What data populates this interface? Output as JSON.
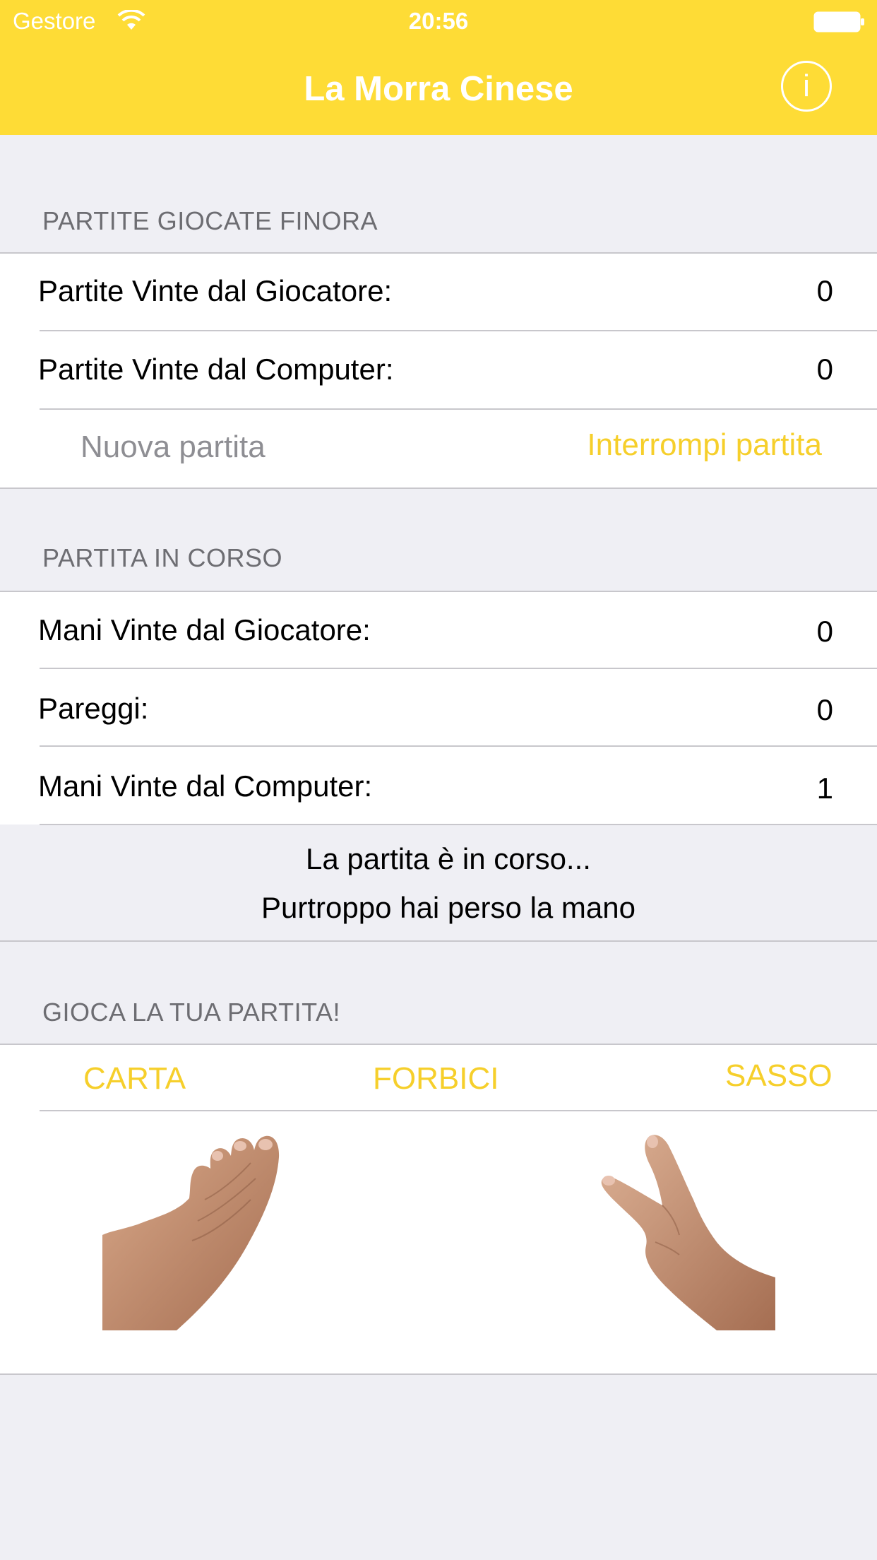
{
  "status_bar": {
    "carrier": "Gestore",
    "time": "20:56"
  },
  "nav": {
    "title": "La Morra Cinese",
    "info_label": "i"
  },
  "played": {
    "header": "PARTITE GIOCATE FINORA",
    "rows": [
      {
        "label": "Partite Vinte dal Giocatore:",
        "value": "0"
      },
      {
        "label": "Partite Vinte dal Computer:",
        "value": "0"
      }
    ],
    "new_game_label": "Nuova partita",
    "stop_game_label": "Interrompi partita"
  },
  "current": {
    "header": "PARTITA IN CORSO",
    "rows": [
      {
        "label": "Mani Vinte dal Giocatore:",
        "value": "0"
      },
      {
        "label": "Pareggi:",
        "value": "0"
      },
      {
        "label": "Mani Vinte dal Computer:",
        "value": "1"
      }
    ],
    "status_line1": "La partita è in corso...",
    "status_line2": "Purtroppo hai perso la mano"
  },
  "play": {
    "header": "GIOCA LA TUA PARTITA!",
    "choices": [
      {
        "label": "CARTA"
      },
      {
        "label": "FORBICI"
      },
      {
        "label": "SASSO"
      }
    ],
    "player_hand_icon": "paper-hand",
    "computer_hand_icon": "scissors-hand"
  },
  "colors": {
    "accent": "#fedc36",
    "link": "#f6cf2b",
    "background": "#efeff4",
    "secondary_text": "#6d6d72",
    "disabled_text": "#8e8e93"
  }
}
